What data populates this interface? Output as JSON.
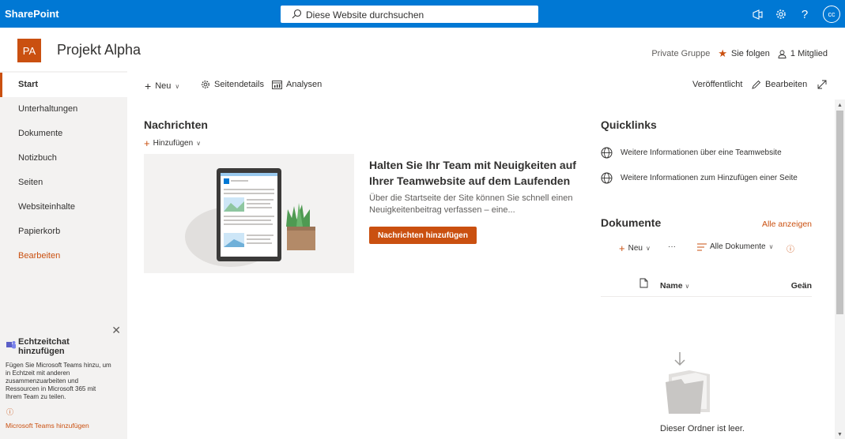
{
  "suite": {
    "brand": "SharePoint",
    "search_placeholder": "Diese Website durchsuchen",
    "icons": [
      "megaphone-icon",
      "gear-icon",
      "help-icon"
    ],
    "help_label": "?",
    "avatar_initials": "cc"
  },
  "site": {
    "logo_initials": "PA",
    "title": "Projekt Alpha",
    "group_type": "Private Gruppe",
    "follow_label": "Sie folgen",
    "members_label": "1 Mitglied"
  },
  "nav": {
    "items": [
      {
        "label": "Start",
        "selected": true
      },
      {
        "label": "Unterhaltungen"
      },
      {
        "label": "Dokumente"
      },
      {
        "label": "Notizbuch"
      },
      {
        "label": "Seiten"
      },
      {
        "label": "Websiteinhalte"
      },
      {
        "label": "Papierkorb"
      }
    ],
    "edit_label": "Bearbeiten"
  },
  "teams_promo": {
    "title_line1": "Echtzeitchat",
    "title_line2": "hinzufügen",
    "description": "Fügen Sie Microsoft Teams hinzu, um in Echtzeit mit anderen zusammenzuarbeiten und Ressourcen in Microsoft 365 mit Ihrem Team zu teilen.",
    "link_label": "Microsoft Teams hinzufügen"
  },
  "command_bar": {
    "new_label": "Neu",
    "page_details_label": "Seitendetails",
    "analytics_label": "Analysen",
    "status_label": "Veröffentlicht",
    "edit_label": "Bearbeiten"
  },
  "news": {
    "title": "Nachrichten",
    "add_label": "Hinzufügen",
    "headline": "Halten Sie Ihr Team mit Neuigkeiten auf Ihrer Teamwebsite auf dem Laufenden",
    "body": "Über die Startseite der Site können Sie schnell einen Neuigkeitenbeitrag verfassen – eine...",
    "button_label": "Nachrichten hinzufügen"
  },
  "quicklinks": {
    "title": "Quicklinks",
    "items": [
      "Weitere Informationen über eine Teamwebsite",
      "Weitere Informationen zum Hinzufügen einer Seite"
    ]
  },
  "documents": {
    "title": "Dokumente",
    "see_all_label": "Alle anzeigen",
    "new_label": "Neu",
    "more_label": "···",
    "view_label": "Alle Dokumente",
    "col_name": "Name",
    "col_modified": "Geän",
    "empty_text": "Dieser Ordner ist leer."
  },
  "colors": {
    "suite_blue": "#0078d4",
    "accent_orange": "#ca5010",
    "nav_bg": "#f3f2f1"
  }
}
